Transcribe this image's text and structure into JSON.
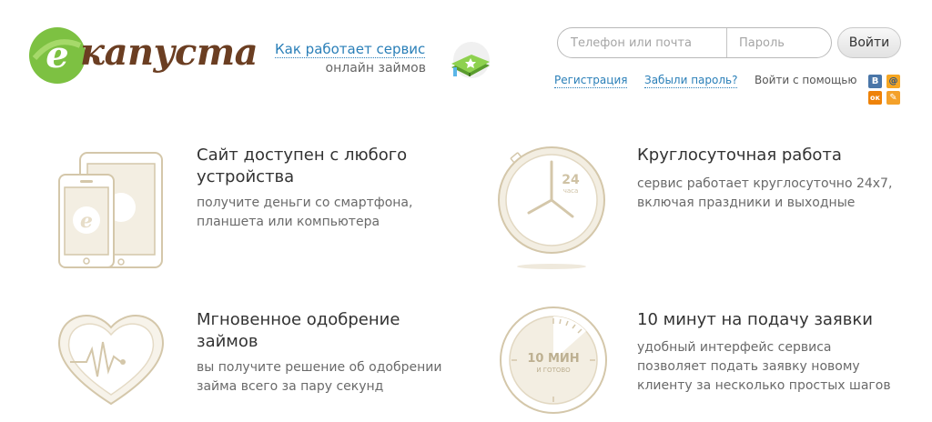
{
  "header": {
    "logo_text": "капуста",
    "logo_letter": "е",
    "how_link": "Как работает сервис",
    "how_sub": "онлайн займов",
    "login": {
      "phone_placeholder": "Телефон или почта",
      "password_placeholder": "Пароль",
      "submit_label": "Войти"
    },
    "register_link": "Регистрация",
    "forgot_link": "Забыли пароль?",
    "social_label": "Войти с помощью",
    "social": [
      {
        "name": "vk-icon",
        "glyph": "В"
      },
      {
        "name": "mail-ru-icon",
        "glyph": "@"
      },
      {
        "name": "odnoklassniki-icon",
        "glyph": "ок"
      },
      {
        "name": "other-social-icon",
        "glyph": "✎"
      }
    ]
  },
  "features": [
    {
      "title": "Сайт доступен с любого устройства",
      "desc": "получите деньги со смартфона, планшета или компьютера",
      "icon": "devices-icon"
    },
    {
      "title": "Круглосуточная работа",
      "desc": "сервис работает круглосуточно 24х7, включая праздники и выходные",
      "icon": "clock-24-icon",
      "badge_top": "24",
      "badge_sub": "часа"
    },
    {
      "title": "Мгновенное одобрение займов",
      "desc": "вы получите решение об одобрении займа всего за пару секунд",
      "icon": "heart-pulse-icon"
    },
    {
      "title": "10 минут на подачу заявки",
      "desc": "удобный интерфейс сервиса позволяет подать заявку новому клиенту за несколько простых шагов",
      "icon": "timer-10-icon",
      "badge_top": "10 МИН",
      "badge_sub": "И ГОТОВО"
    }
  ],
  "colors": {
    "brand_green": "#7dc142",
    "brand_brown": "#6b3e22",
    "link_blue": "#2a7fb8",
    "icon_beige": "#d9ccb0"
  }
}
